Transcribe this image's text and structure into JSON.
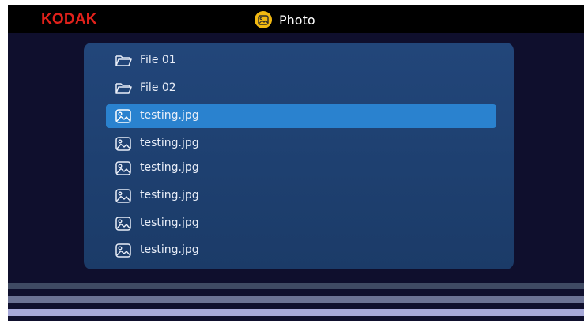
{
  "header": {
    "brand": "KODAK",
    "title": "Photo",
    "title_icon": "image-icon"
  },
  "colors": {
    "brand": "#e1211b",
    "accent_icon": "#f2b911",
    "selected_row": "#2a82cf",
    "panel": "#1e4070",
    "background": "#0f0f2d"
  },
  "file_list": {
    "items": [
      {
        "label": "File 01",
        "icon": "folder-icon",
        "selected": false
      },
      {
        "label": "File 02",
        "icon": "folder-icon",
        "selected": false
      },
      {
        "label": "testing.jpg",
        "icon": "image-icon",
        "selected": true
      },
      {
        "label": "testing.jpg",
        "icon": "image-icon",
        "selected": false
      },
      {
        "label": "testing.jpg",
        "icon": "image-icon",
        "selected": false
      },
      {
        "label": "testing.jpg",
        "icon": "image-icon",
        "selected": false
      },
      {
        "label": "testing.jpg",
        "icon": "image-icon",
        "selected": false
      },
      {
        "label": "testing.jpg",
        "icon": "image-icon",
        "selected": false
      }
    ]
  }
}
